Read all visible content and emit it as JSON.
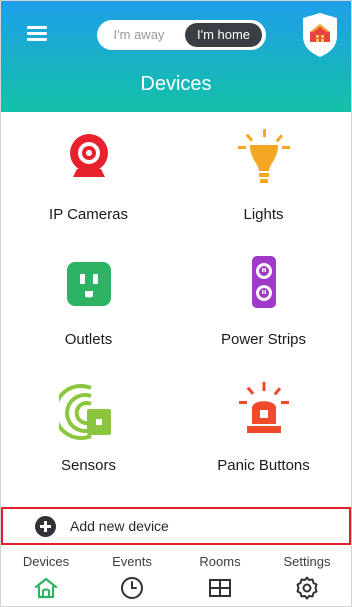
{
  "header": {
    "mode_away_label": "I'm away",
    "mode_home_label": "I'm home",
    "active_mode": "home",
    "title": "Devices"
  },
  "devices": [
    {
      "label": "IP Cameras",
      "icon": "camera-icon",
      "color": "#E8222D"
    },
    {
      "label": "Lights",
      "icon": "light-bulb-icon",
      "color": "#F5A623"
    },
    {
      "label": "Outlets",
      "icon": "outlet-icon",
      "color": "#2DB363"
    },
    {
      "label": "Power Strips",
      "icon": "power-strip-icon",
      "color": "#A03AC8"
    },
    {
      "label": "Sensors",
      "icon": "sensor-icon",
      "color": "#8CC63F"
    },
    {
      "label": "Panic Buttons",
      "icon": "panic-button-icon",
      "color": "#F0492C"
    }
  ],
  "add_device": {
    "label": "Add new device",
    "icon": "plus-circle-icon"
  },
  "tabs": [
    {
      "label": "Devices",
      "icon": "home-icon",
      "active": true
    },
    {
      "label": "Events",
      "icon": "clock-icon",
      "active": false
    },
    {
      "label": "Rooms",
      "icon": "rooms-grid-icon",
      "active": false
    },
    {
      "label": "Settings",
      "icon": "gear-icon",
      "active": false
    }
  ],
  "colors": {
    "header_gradient_top": "#1E9EEA",
    "header_gradient_bottom": "#14C1A8",
    "active_tab_icon": "#2DB363",
    "highlight_border": "#E0202B"
  }
}
